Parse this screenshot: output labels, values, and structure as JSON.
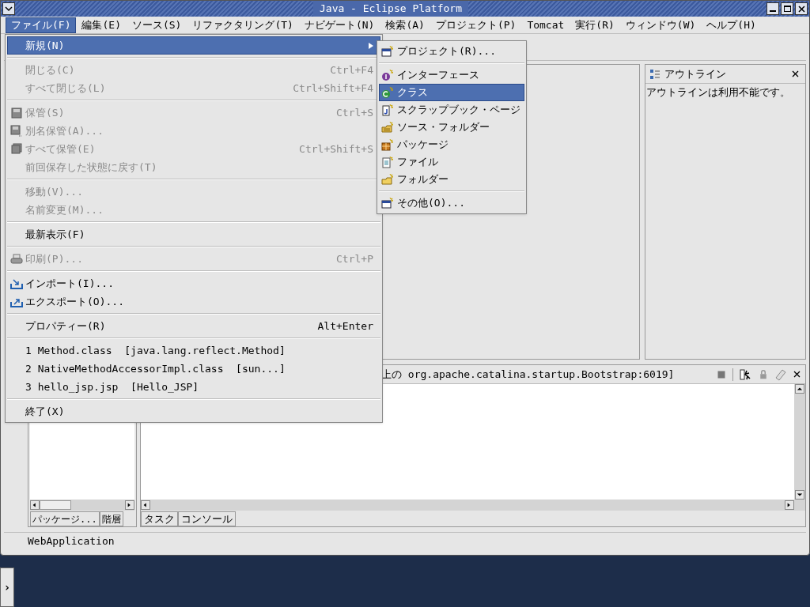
{
  "window": {
    "title": "Java - Eclipse Platform"
  },
  "menubar": [
    {
      "label": "ファイル(F)",
      "selected": true
    },
    {
      "label": "編集(E)",
      "selected": false
    },
    {
      "label": "ソース(S)",
      "selected": false
    },
    {
      "label": "リファクタリング(T)",
      "selected": false
    },
    {
      "label": "ナビゲート(N)",
      "selected": false
    },
    {
      "label": "検索(A)",
      "selected": false
    },
    {
      "label": "プロジェクト(P)",
      "selected": false
    },
    {
      "label": "Tomcat",
      "selected": false
    },
    {
      "label": "実行(R)",
      "selected": false
    },
    {
      "label": "ウィンドウ(W)",
      "selected": false
    },
    {
      "label": "ヘルプ(H)",
      "selected": false
    }
  ],
  "file_menu": [
    {
      "kind": "item",
      "label": "新規(N)",
      "selected": true,
      "disabled": false,
      "submenu": true
    },
    {
      "kind": "separator"
    },
    {
      "kind": "item",
      "label": "閉じる(C)",
      "shortcut": "Ctrl+F4",
      "selected": false,
      "disabled": true,
      "submenu": false
    },
    {
      "kind": "item",
      "label": "すべて閉じる(L)",
      "shortcut": "Ctrl+Shift+F4",
      "selected": false,
      "disabled": true,
      "submenu": false
    },
    {
      "kind": "separator"
    },
    {
      "kind": "item",
      "label": "保管(S)",
      "shortcut": "Ctrl+S",
      "selected": false,
      "disabled": true,
      "submenu": false
    },
    {
      "kind": "item",
      "label": "別名保管(A)...",
      "selected": false,
      "disabled": true,
      "submenu": false
    },
    {
      "kind": "item",
      "label": "すべて保管(E)",
      "shortcut": "Ctrl+Shift+S",
      "selected": false,
      "disabled": true,
      "submenu": false
    },
    {
      "kind": "item",
      "label": "前回保存した状態に戻す(T)",
      "selected": false,
      "disabled": true,
      "submenu": false
    },
    {
      "kind": "separator"
    },
    {
      "kind": "item",
      "label": "移動(V)...",
      "selected": false,
      "disabled": true,
      "submenu": false
    },
    {
      "kind": "item",
      "label": "名前変更(M)...",
      "selected": false,
      "disabled": true,
      "submenu": false
    },
    {
      "kind": "separator"
    },
    {
      "kind": "item",
      "label": "最新表示(F)",
      "selected": false,
      "disabled": false,
      "submenu": false
    },
    {
      "kind": "separator"
    },
    {
      "kind": "item",
      "label": "印刷(P)...",
      "shortcut": "Ctrl+P",
      "selected": false,
      "disabled": true,
      "submenu": false
    },
    {
      "kind": "separator"
    },
    {
      "kind": "item",
      "label": "インポート(I)...",
      "selected": false,
      "disabled": false,
      "submenu": false
    },
    {
      "kind": "item",
      "label": "エクスポート(O)...",
      "selected": false,
      "disabled": false,
      "submenu": false
    },
    {
      "kind": "separator"
    },
    {
      "kind": "item",
      "label": "プロパティー(R)",
      "shortcut": "Alt+Enter",
      "selected": false,
      "disabled": false,
      "submenu": false
    },
    {
      "kind": "separator"
    },
    {
      "kind": "item",
      "label": "1 Method.class  [java.lang.reflect.Method]",
      "selected": false,
      "disabled": false,
      "submenu": false
    },
    {
      "kind": "item",
      "label": "2 NativeMethodAccessorImpl.class  [sun...]",
      "selected": false,
      "disabled": false,
      "submenu": false
    },
    {
      "kind": "item",
      "label": "3 hello_jsp.jsp  [Hello_JSP]",
      "selected": false,
      "disabled": false,
      "submenu": false
    },
    {
      "kind": "separator"
    },
    {
      "kind": "item",
      "label": "終了(X)",
      "selected": false,
      "disabled": false,
      "submenu": false
    }
  ],
  "new_submenu": [
    {
      "kind": "item",
      "label": "プロジェクト(R)...",
      "selected": false
    },
    {
      "kind": "separator"
    },
    {
      "kind": "item",
      "label": "インターフェース",
      "selected": false
    },
    {
      "kind": "item",
      "label": "クラス",
      "selected": true
    },
    {
      "kind": "item",
      "label": "スクラップブック・ページ",
      "selected": false
    },
    {
      "kind": "item",
      "label": "ソース・フォルダー",
      "selected": false
    },
    {
      "kind": "item",
      "label": "パッケージ",
      "selected": false
    },
    {
      "kind": "item",
      "label": "ファイル",
      "selected": false
    },
    {
      "kind": "item",
      "label": "フォルダー",
      "selected": false
    },
    {
      "kind": "separator"
    },
    {
      "kind": "item",
      "label": "その他(O)...",
      "selected": false
    }
  ],
  "outline": {
    "title": "アウトライン",
    "message": "アウトラインは利用不能です。"
  },
  "console": {
    "title": "上の org.apache.catalina.startup.Bootstrap:6019]"
  },
  "left_tabs": [
    "パッケージ...",
    "階層"
  ],
  "bottom_tabs": [
    "タスク",
    "コンソール"
  ],
  "status_bar": "WebApplication",
  "taskbar": {
    "toggle": "›"
  }
}
